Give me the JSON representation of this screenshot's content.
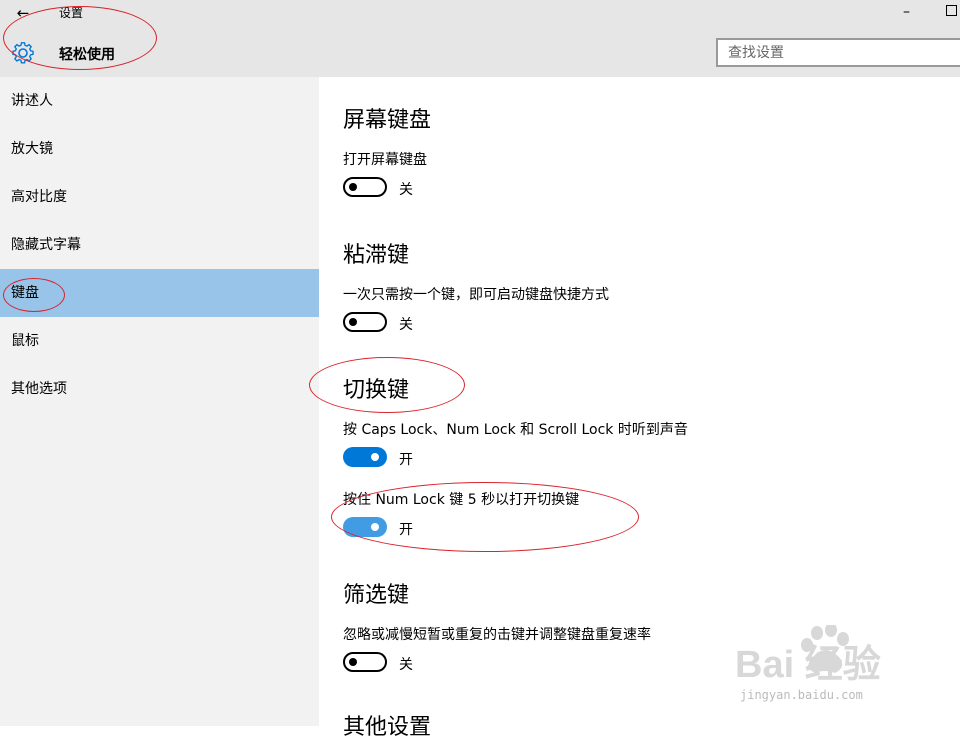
{
  "window": {
    "back_glyph": "←",
    "app_title": "设置",
    "minimize_glyph": "–"
  },
  "header": {
    "page_title": "轻松使用",
    "search_placeholder": "查找设置"
  },
  "sidebar": {
    "items": [
      {
        "label": "讲述人"
      },
      {
        "label": "放大镜"
      },
      {
        "label": "高对比度"
      },
      {
        "label": "隐藏式字幕"
      },
      {
        "label": "键盘",
        "active": true
      },
      {
        "label": "鼠标"
      },
      {
        "label": "其他选项"
      }
    ]
  },
  "content": {
    "sections": [
      {
        "title": "屏幕键盘",
        "settings": [
          {
            "description": "打开屏幕键盘",
            "state_label": "关",
            "on": false
          }
        ]
      },
      {
        "title": "粘滞键",
        "settings": [
          {
            "description": "一次只需按一个键，即可启动键盘快捷方式",
            "state_label": "关",
            "on": false
          }
        ]
      },
      {
        "title": "切换键",
        "settings": [
          {
            "description": "按 Caps Lock、Num Lock 和 Scroll Lock 时听到声音",
            "state_label": "开",
            "on": true
          },
          {
            "description": "按住 Num Lock 键 5 秒以打开切换键",
            "state_label": "开",
            "on": true
          }
        ]
      },
      {
        "title": "筛选键",
        "settings": [
          {
            "description": "忽略或减慢短暂或重复的击键并调整键盘重复速率",
            "state_label": "关",
            "on": false
          }
        ]
      },
      {
        "title": "其他设置"
      }
    ]
  },
  "watermark": {
    "text": "Bai 经验",
    "url_text": "jingyan.baidu.com"
  },
  "colors": {
    "accent": "#0078d7",
    "accent_light": "#429ce3",
    "selected": "#98c4e9",
    "annotation": "#d9242c"
  }
}
